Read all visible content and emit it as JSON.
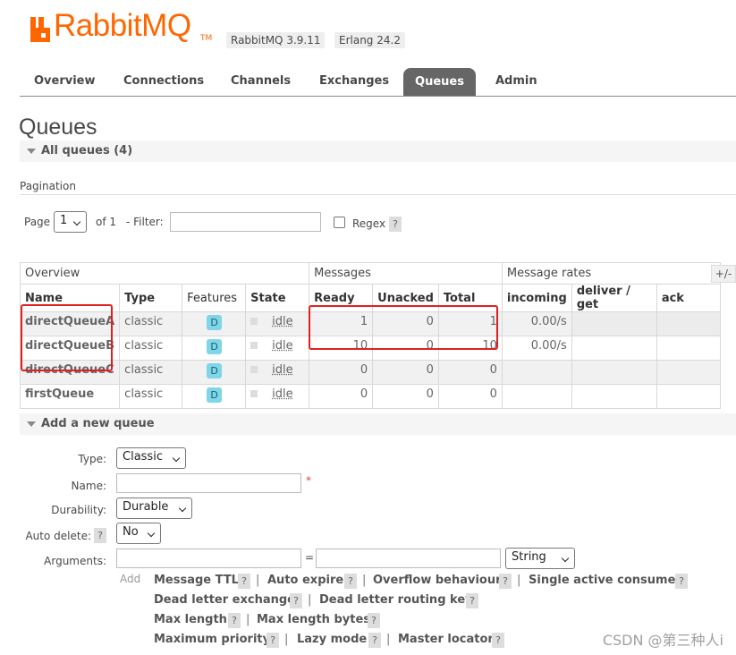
{
  "header": {
    "logo_text": "RabbitMQ",
    "logo_tm": "TM",
    "version": "RabbitMQ 3.9.11",
    "erlang": "Erlang 24.2"
  },
  "tabs": [
    {
      "label": "Overview"
    },
    {
      "label": "Connections"
    },
    {
      "label": "Channels"
    },
    {
      "label": "Exchanges"
    },
    {
      "label": "Queues",
      "active": true
    },
    {
      "label": "Admin"
    }
  ],
  "page_title": "Queues",
  "all_queues_label": "All queues (4)",
  "pagination": {
    "label": "Pagination",
    "page_label": "Page",
    "page_value": "1",
    "of_label": "of 1",
    "filter_label": "- Filter:",
    "filter_value": "",
    "regex_label": "Regex",
    "help": "?"
  },
  "table": {
    "group_overview": "Overview",
    "group_messages": "Messages",
    "group_rates": "Message rates",
    "toggle_columns": "+/-",
    "headers": [
      "Name",
      "Type",
      "Features",
      "State",
      "Ready",
      "Unacked",
      "Total",
      "incoming",
      "deliver / get",
      "ack"
    ],
    "rows": [
      {
        "name": "directQueueA",
        "type": "classic",
        "feature": "D",
        "state": "idle",
        "ready": "1",
        "unacked": "0",
        "total": "1",
        "incoming": "0.00/s",
        "deliver": "",
        "ack": ""
      },
      {
        "name": "directQueueB",
        "type": "classic",
        "feature": "D",
        "state": "idle",
        "ready": "10",
        "unacked": "0",
        "total": "10",
        "incoming": "0.00/s",
        "deliver": "",
        "ack": ""
      },
      {
        "name": "directQueueC",
        "type": "classic",
        "feature": "D",
        "state": "idle",
        "ready": "0",
        "unacked": "0",
        "total": "0",
        "incoming": "",
        "deliver": "",
        "ack": ""
      },
      {
        "name": "firstQueue",
        "type": "classic",
        "feature": "D",
        "state": "idle",
        "ready": "0",
        "unacked": "0",
        "total": "0",
        "incoming": "",
        "deliver": "",
        "ack": ""
      }
    ]
  },
  "add_queue": {
    "section_label": "Add a new queue",
    "type_label": "Type:",
    "type_value": "Classic",
    "name_label": "Name:",
    "name_value": "",
    "required_mark": "*",
    "durability_label": "Durability:",
    "durability_value": "Durable",
    "auto_delete_label": "Auto delete:",
    "auto_delete_value": "No",
    "arguments_label": "Arguments:",
    "equals": "=",
    "arg_type_value": "String",
    "add_label": "Add",
    "separator": "|",
    "options_row1": [
      "Message TTL",
      "Auto expire",
      "Overflow behaviour",
      "Single active consumer"
    ],
    "options_row2": [
      "Dead letter exchange",
      "Dead letter routing key"
    ],
    "options_row3": [
      "Max length",
      "Max length bytes"
    ],
    "options_row4": [
      "Maximum priority",
      "Lazy mode",
      "Master locator"
    ]
  },
  "watermark": "CSDN @第三种人i",
  "colors": {
    "brand": "#ff6600",
    "active_tab": "#666666",
    "highlight": "#e02020",
    "badge": "#7ed6e8"
  }
}
